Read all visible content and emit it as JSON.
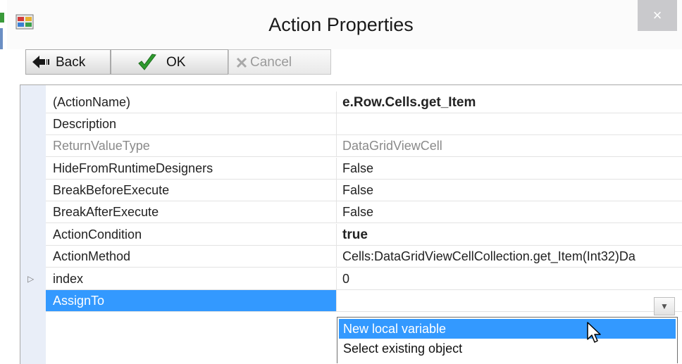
{
  "window": {
    "title": "Action Properties",
    "close_label": "×"
  },
  "toolbar": {
    "back_label": "Back",
    "ok_label": "OK",
    "cancel_label": "Cancel"
  },
  "properties": [
    {
      "name": "(ActionName)",
      "value": "e.Row.Cells.get_Item",
      "style": "bold"
    },
    {
      "name": "Description",
      "value": "",
      "style": "normal"
    },
    {
      "name": "ReturnValueType",
      "value": "DataGridViewCell",
      "style": "gray"
    },
    {
      "name": "HideFromRuntimeDesigners",
      "value": "False",
      "style": "normal"
    },
    {
      "name": "BreakBeforeExecute",
      "value": "False",
      "style": "normal"
    },
    {
      "name": "BreakAfterExecute",
      "value": "False",
      "style": "normal"
    },
    {
      "name": "ActionCondition",
      "value": "true",
      "style": "bold"
    },
    {
      "name": "ActionMethod",
      "value": "Cells:DataGridViewCellCollection.get_Item(Int32)Da",
      "style": "normal"
    },
    {
      "name": "index",
      "value": "0",
      "style": "normal",
      "expandable": true
    },
    {
      "name": "AssignTo",
      "value": "",
      "style": "selected"
    }
  ],
  "dropdown": {
    "items": [
      "New local variable",
      "Select existing object"
    ],
    "highlighted": 0
  },
  "colors": {
    "selection": "#3399ff",
    "margin": "#e9eef8",
    "ok_check": "#2e9a2e"
  }
}
